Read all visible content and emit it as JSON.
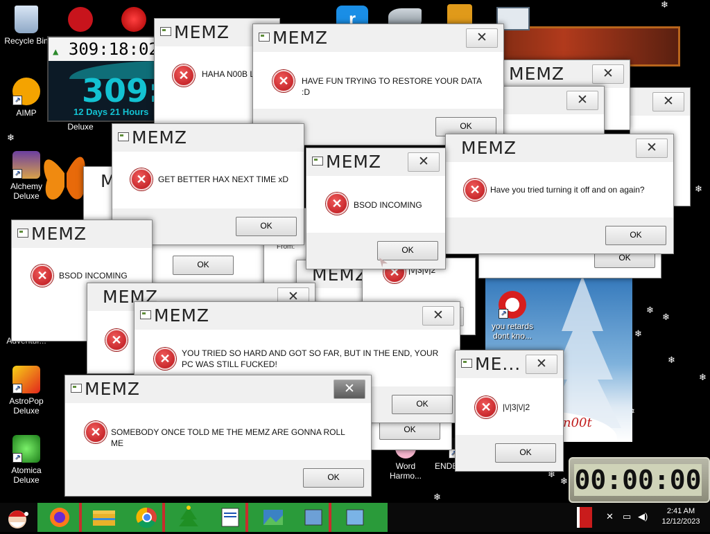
{
  "desktop_icons": [
    {
      "label": "Recycle Bin",
      "icon": "recycle-bin-icon"
    },
    {
      "label": "AIMP",
      "icon": "aimp-icon"
    },
    {
      "label": "Deluxe",
      "icon": "game-icon"
    },
    {
      "label": "Alchemy Deluxe",
      "icon": "alchemy-wizard-icon"
    },
    {
      "label": "AstroPop Deluxe",
      "icon": "astropop-icon"
    },
    {
      "label": "Atomica Deluxe",
      "icon": "atomica-icon"
    },
    {
      "label": "you retards dont kno...",
      "icon": "red-dragon-icon"
    },
    {
      "label": "Word Harmo...",
      "icon": "word-harmony-icon"
    },
    {
      "label": "ENDERMA...",
      "icon": "enderman-icon"
    },
    {
      "label": "Adventur...",
      "icon": "game-icon"
    }
  ],
  "widget_counter": {
    "digits": "309:18:02",
    "big": "309:",
    "sub": "12 Days 21 Hours"
  },
  "popups": [
    {
      "title": "MEMZ",
      "message": "HAHA N00B L2",
      "ok": "OK"
    },
    {
      "title": "MEMZ",
      "message": "HAVE FUN TRYING TO RESTORE YOUR DATA :D",
      "ok": "OK"
    },
    {
      "title": "MEMZ",
      "message": "",
      "ok": "OK"
    },
    {
      "title": "MEMZ",
      "message": "GET BETTER HAX NEXT TIME xD",
      "ok": "OK"
    },
    {
      "title": "MEMZ",
      "message": "BSOD INCOMING",
      "ok": "OK"
    },
    {
      "title": "MEMZ",
      "message": "Have you tried turning it off and on again?",
      "ok": "OK"
    },
    {
      "title": "MEMZ",
      "message": "BSOD INCOMING",
      "ok": "OK"
    },
    {
      "title": "MEMZ",
      "message": "YOU TRIED SO HARD AND GOT SO FAR, BUT IN THE END, YOUR PC WAS STILL FUCKED!",
      "ok": "OK"
    },
    {
      "title": "ME...",
      "message": "|\\/|3|\\/|2",
      "ok": "OK"
    },
    {
      "title": "MEMZ",
      "message": "SOMEBODY ONCE TOLD ME THE MEMZ ARE GONNA ROLL ME",
      "ok": "OK"
    },
    {
      "title": "MEMZ",
      "message": "",
      "ok": ""
    },
    {
      "title": "MEMZ",
      "message": "",
      "ok": ""
    }
  ],
  "background_fragments": {
    "ok_1": "OK",
    "ok_2": "OK",
    "ok_3": "OK",
    "from": "From:",
    "meme_text": "|\\/|3|\\/|2",
    "n00t": "n00t"
  },
  "countdown": "00:00:00",
  "clock": {
    "time": "2:41 AM",
    "date": "12/12/2023"
  },
  "taskbar_apps": [
    "firefox-icon",
    "file-explorer-icon",
    "chrome-icon",
    "christmas-tree-icon",
    "notepad-icon",
    "image-icon",
    "app-icon",
    "app-icon"
  ],
  "colors": {
    "error_red": "#c8141c",
    "titlebar": "#f0f0f0",
    "widget_teal": "#0fa5b0",
    "counter_blue": "#1b2b8a"
  }
}
